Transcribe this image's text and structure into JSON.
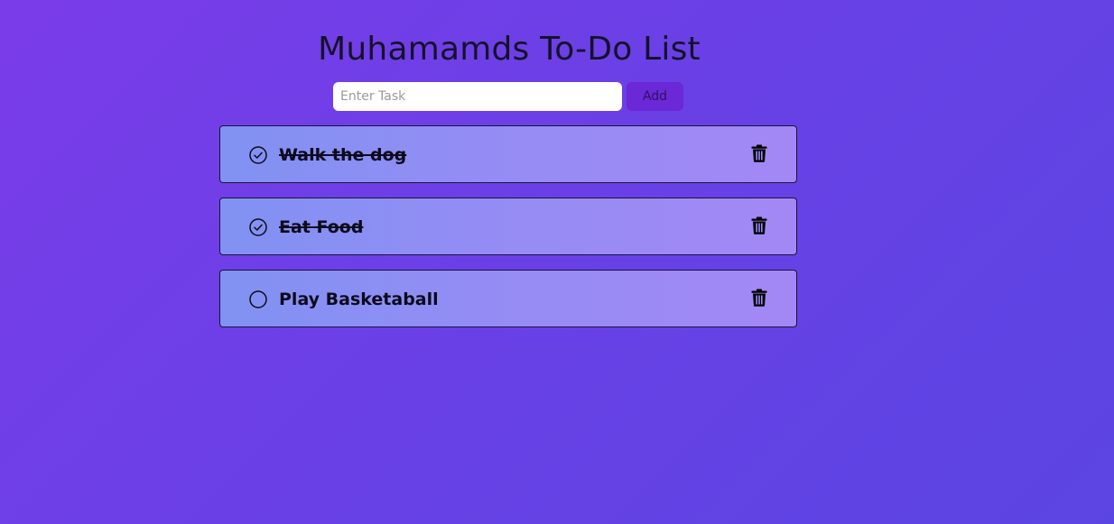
{
  "header": {
    "title": "Muhamamds To-Do List"
  },
  "form": {
    "input_value": "",
    "input_placeholder": "Enter Task",
    "add_label": "Add"
  },
  "tasks": [
    {
      "text": "Walk the dog",
      "completed": true
    },
    {
      "text": "Eat Food",
      "completed": true
    },
    {
      "text": "Play Basketaball",
      "completed": false
    }
  ],
  "icons": {
    "check": "check-circle-icon",
    "uncheck": "empty-circle-icon",
    "delete": "trash-icon"
  },
  "colors": {
    "background_start": "#7a3ce8",
    "background_end": "#5b45e2",
    "button": "#6a28d6",
    "item_start": "#8192f2",
    "item_end": "#a388f5",
    "text": "#0c0a1c"
  }
}
